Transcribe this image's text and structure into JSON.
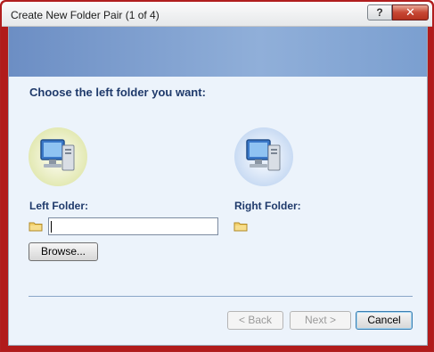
{
  "window": {
    "title": "Create New Folder Pair (1 of 4)",
    "help_glyph": "?",
    "close_glyph": "✕"
  },
  "page": {
    "heading": "Choose the left folder you want:"
  },
  "left": {
    "label": "Left Folder:",
    "input_value": "",
    "browse_label": "Browse..."
  },
  "right": {
    "label": "Right Folder:"
  },
  "footer": {
    "back_label": "< Back",
    "next_label": "Next >",
    "cancel_label": "Cancel"
  },
  "icons": {
    "left_computer": "computer-icon",
    "right_computer": "computer-icon",
    "folder": "folder-icon"
  },
  "colors": {
    "heading": "#1f3a6b",
    "banner": "#7b9fd0",
    "frame_accent": "#b11b1b"
  }
}
